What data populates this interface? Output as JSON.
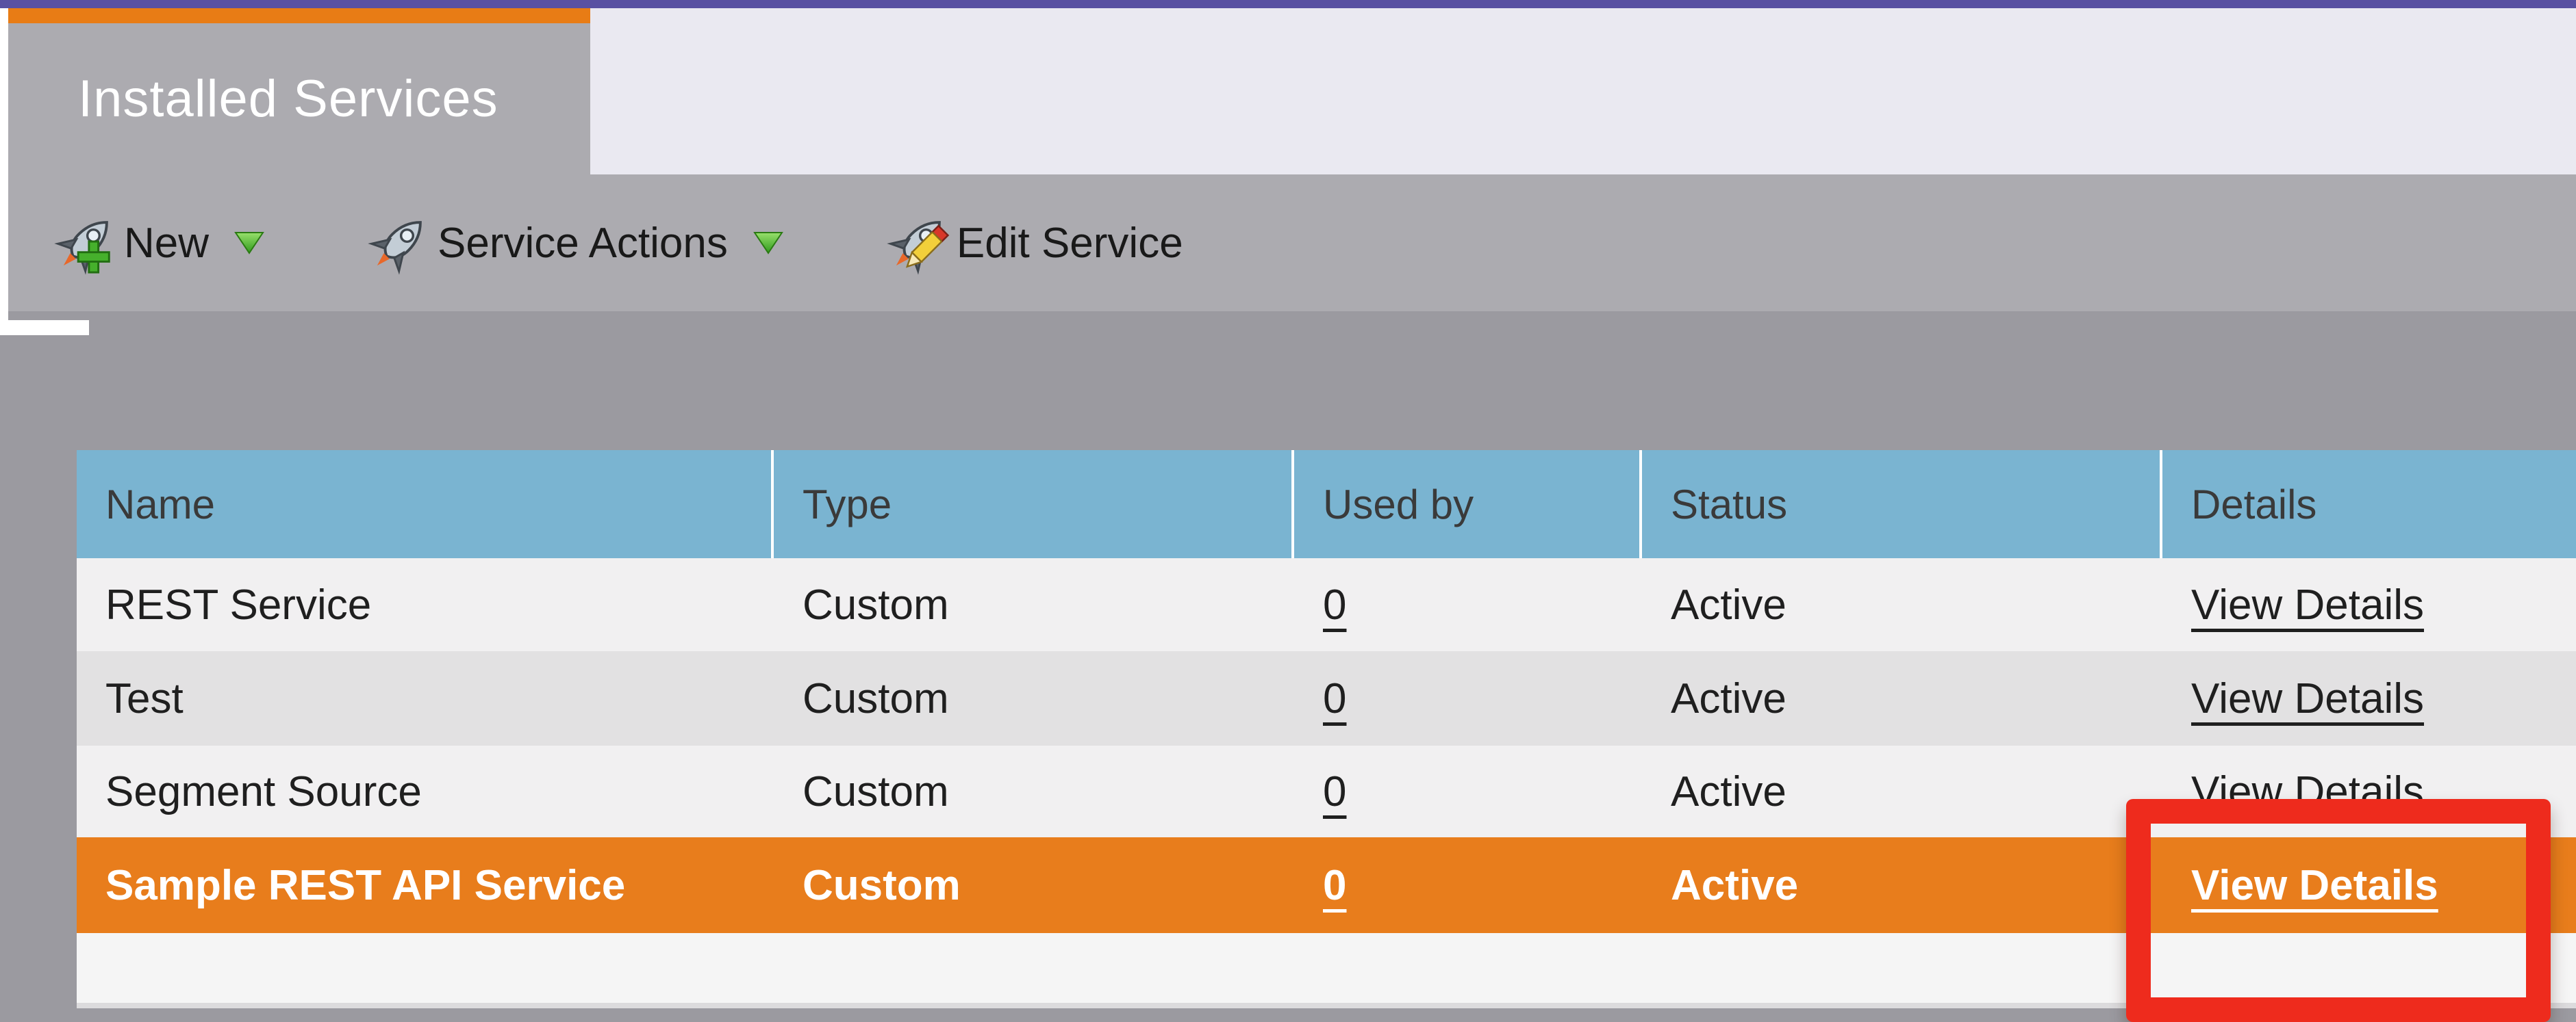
{
  "tab": {
    "title": "Installed Services"
  },
  "toolbar": {
    "buttons": [
      {
        "label": "New",
        "icon": "rocket-plus-icon",
        "has_dropdown": true
      },
      {
        "label": "Service Actions",
        "icon": "rocket-icon",
        "has_dropdown": true
      },
      {
        "label": "Edit Service",
        "icon": "rocket-pencil-icon",
        "has_dropdown": false
      }
    ]
  },
  "table": {
    "columns": [
      {
        "label": "Name"
      },
      {
        "label": "Type"
      },
      {
        "label": "Used by"
      },
      {
        "label": "Status"
      },
      {
        "label": "Details"
      }
    ],
    "rows": [
      {
        "name": "REST Service",
        "type": "Custom",
        "used_by": "0",
        "status": "Active",
        "details_link": "View Details",
        "selected": false
      },
      {
        "name": "Test",
        "type": "Custom",
        "used_by": "0",
        "status": "Active",
        "details_link": "View Details",
        "selected": false
      },
      {
        "name": "Segment Source",
        "type": "Custom",
        "used_by": "0",
        "status": "Active",
        "details_link": "View Details",
        "selected": false
      },
      {
        "name": "Sample REST API Service",
        "type": "Custom",
        "used_by": "0",
        "status": "Active",
        "details_link": "View Details",
        "selected": true
      }
    ]
  },
  "annotation": {
    "purpose": "red highlight box around the View Details link of the selected Sample REST API Service row",
    "color": "#ee2b1d"
  },
  "colors": {
    "top_bar_purple": "#5951a2",
    "tab_accent_orange": "#e87c15",
    "selected_row_orange": "#e87d1c",
    "header_blue": "#7ab4d1",
    "toolbar_gray": "#acabb0",
    "page_gray": "#9b9aa0",
    "lavender_band": "#eae9f1"
  }
}
